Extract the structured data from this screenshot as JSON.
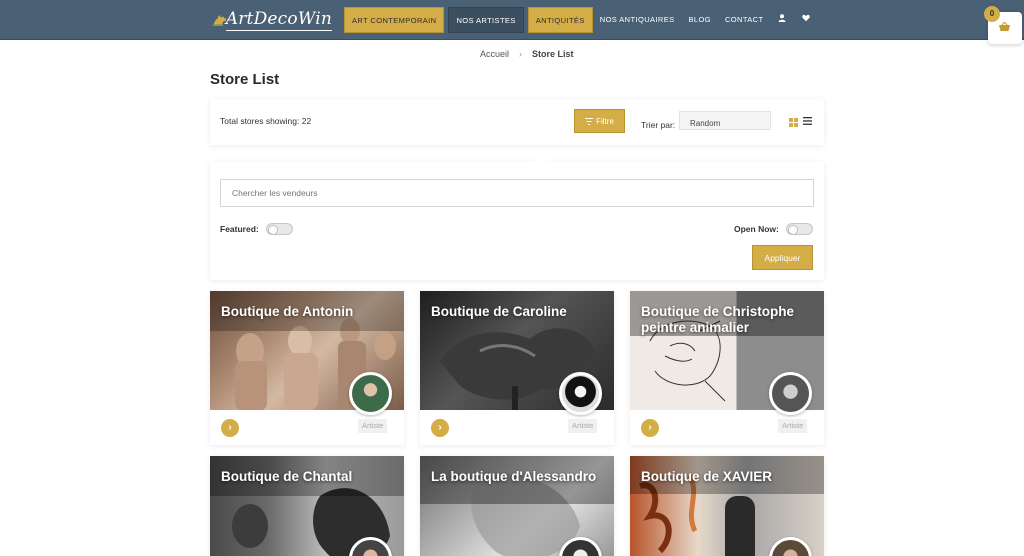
{
  "header": {
    "logo_text": "ArtDecoWin",
    "nav": [
      {
        "label": "Art Contemporain"
      },
      {
        "label": "Nos Artistes"
      },
      {
        "label": "Antiquités"
      },
      {
        "label": "Nos Antiquaires"
      },
      {
        "label": "Blog"
      },
      {
        "label": "Contact"
      }
    ],
    "icons": [
      "user-icon",
      "heart-icon"
    ],
    "cart_count": "0"
  },
  "breadcrumb": {
    "home": "Accueil",
    "current": "Store List"
  },
  "page_title": "Store List",
  "toolbar": {
    "total_text": "Total stores showing: 22",
    "filter_label": "Filtre",
    "sort_label": "Trier par:",
    "sort_value": "Random"
  },
  "filter_panel": {
    "search_placeholder": "Chercher les vendeurs",
    "featured_label": "Featured:",
    "open_now_label": "Open Now:",
    "apply_label": "Appliquer"
  },
  "stores": [
    {
      "title": "Boutique de Antonin",
      "tag": "Artiste"
    },
    {
      "title": "Boutique de Caroline",
      "tag": "Artiste"
    },
    {
      "title": "Boutique de Christophe peintre animalier",
      "tag": "Artiste"
    },
    {
      "title": "Boutique de Chantal",
      "tag": ""
    },
    {
      "title": "La boutique d'Alessandro",
      "tag": ""
    },
    {
      "title": "Boutique de XAVIER",
      "tag": ""
    }
  ],
  "colors": {
    "accent": "#d4ad47",
    "header_bg": "#4a6075"
  }
}
